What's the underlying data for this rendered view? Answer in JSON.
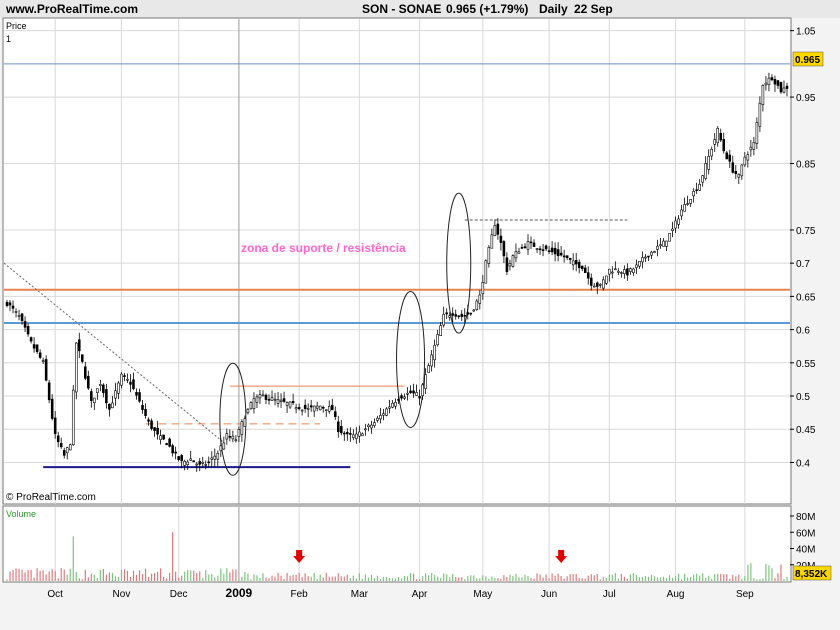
{
  "header": {
    "site": "www.ProRealTime.com",
    "symbol": "SON - SONAE",
    "quote": "0.965 (+1.79%)",
    "period": "Daily",
    "date": "22 Sep"
  },
  "price_panel": {
    "label_price": "Price",
    "label_one": "1",
    "copyright": "© ProRealTime.com",
    "annotation": "zona de suporte / resistência",
    "last_price": "0.965"
  },
  "volume_panel": {
    "label": "Volume",
    "last_volume": "8,352K",
    "ticks": [
      "80M",
      "60M",
      "40M",
      "20M"
    ]
  },
  "chart_data": {
    "type": "candlestick",
    "y_ticks": [
      1.05,
      0.95,
      0.85,
      0.75,
      0.7,
      0.65,
      0.6,
      0.55,
      0.5,
      0.45,
      0.4
    ],
    "y_tick_labels": [
      "1.05",
      "0.95",
      "0.85",
      "0.75",
      "0.7",
      "0.65",
      "0.6",
      "0.55",
      "0.5",
      "0.45",
      "0.4"
    ],
    "x_tick_labels": [
      "Oct",
      "Nov",
      "Dec",
      "2009",
      "Feb",
      "Mar",
      "Apr",
      "May",
      "Jun",
      "Jul",
      "Aug",
      "Sep"
    ],
    "x_ticks_idx": [
      16,
      38,
      57,
      77,
      97,
      117,
      137,
      158,
      180,
      200,
      222,
      245
    ],
    "x_count": 260,
    "ylim": [
      0.345,
      1.06
    ],
    "close_points": [
      [
        0,
        0.64
      ],
      [
        4,
        0.62
      ],
      [
        8,
        0.58
      ],
      [
        12,
        0.55
      ],
      [
        16,
        0.44
      ],
      [
        19,
        0.41
      ],
      [
        21,
        0.43
      ],
      [
        23,
        0.58
      ],
      [
        25,
        0.55
      ],
      [
        28,
        0.49
      ],
      [
        31,
        0.52
      ],
      [
        34,
        0.48
      ],
      [
        38,
        0.53
      ],
      [
        41,
        0.52
      ],
      [
        44,
        0.49
      ],
      [
        47,
        0.46
      ],
      [
        50,
        0.44
      ],
      [
        53,
        0.43
      ],
      [
        56,
        0.41
      ],
      [
        58,
        0.4
      ],
      [
        61,
        0.405
      ],
      [
        64,
        0.395
      ],
      [
        67,
        0.4
      ],
      [
        70,
        0.415
      ],
      [
        73,
        0.44
      ],
      [
        76,
        0.435
      ],
      [
        79,
        0.47
      ],
      [
        82,
        0.495
      ],
      [
        85,
        0.5
      ],
      [
        88,
        0.495
      ],
      [
        92,
        0.49
      ],
      [
        96,
        0.485
      ],
      [
        100,
        0.48
      ],
      [
        104,
        0.485
      ],
      [
        108,
        0.48
      ],
      [
        110,
        0.45
      ],
      [
        113,
        0.44
      ],
      [
        116,
        0.44
      ],
      [
        119,
        0.45
      ],
      [
        122,
        0.46
      ],
      [
        125,
        0.475
      ],
      [
        128,
        0.49
      ],
      [
        131,
        0.5
      ],
      [
        134,
        0.505
      ],
      [
        137,
        0.5
      ],
      [
        139,
        0.53
      ],
      [
        141,
        0.56
      ],
      [
        143,
        0.59
      ],
      [
        145,
        0.62
      ],
      [
        148,
        0.625
      ],
      [
        151,
        0.62
      ],
      [
        154,
        0.625
      ],
      [
        157,
        0.65
      ],
      [
        159,
        0.7
      ],
      [
        162,
        0.76
      ],
      [
        164,
        0.73
      ],
      [
        166,
        0.69
      ],
      [
        168,
        0.71
      ],
      [
        170,
        0.72
      ],
      [
        173,
        0.73
      ],
      [
        176,
        0.725
      ],
      [
        179,
        0.72
      ],
      [
        182,
        0.715
      ],
      [
        185,
        0.71
      ],
      [
        188,
        0.7
      ],
      [
        191,
        0.695
      ],
      [
        194,
        0.67
      ],
      [
        197,
        0.665
      ],
      [
        200,
        0.69
      ],
      [
        203,
        0.69
      ],
      [
        206,
        0.685
      ],
      [
        209,
        0.695
      ],
      [
        212,
        0.71
      ],
      [
        215,
        0.72
      ],
      [
        218,
        0.73
      ],
      [
        221,
        0.75
      ],
      [
        224,
        0.78
      ],
      [
        227,
        0.8
      ],
      [
        230,
        0.82
      ],
      [
        233,
        0.86
      ],
      [
        236,
        0.9
      ],
      [
        238,
        0.87
      ],
      [
        241,
        0.84
      ],
      [
        243,
        0.83
      ],
      [
        245,
        0.86
      ],
      [
        248,
        0.88
      ],
      [
        251,
        0.97
      ],
      [
        254,
        0.98
      ],
      [
        257,
        0.96
      ],
      [
        259,
        0.965
      ]
    ],
    "volume_spikes": [
      [
        22,
        55
      ],
      [
        55,
        60
      ]
    ],
    "support_line": 0.66,
    "resistance_line": 0.61,
    "top_line": 1.0,
    "low_line": 0.393
  }
}
